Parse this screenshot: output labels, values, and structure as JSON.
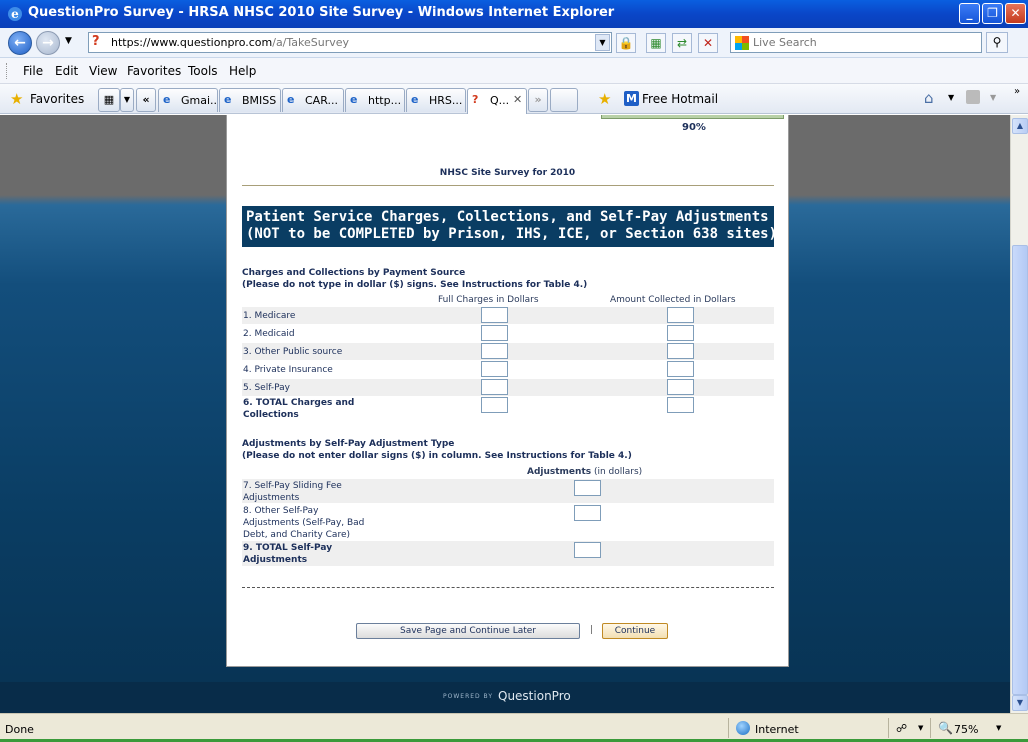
{
  "window": {
    "title": "QuestionPro Survey - HRSA NHSC 2010 Site Survey - Windows Internet Explorer",
    "minimize": "_",
    "maximize": "❐",
    "close": "✕"
  },
  "address": {
    "url_prefix": "https://",
    "url_host": "www.questionpro.com",
    "url_path": "/a/TakeSurvey",
    "search_placeholder": "Live Search"
  },
  "menu": [
    "File",
    "Edit",
    "View",
    "Favorites",
    "Tools",
    "Help"
  ],
  "favorites_bar": {
    "favorites_label": "Favorites",
    "tabs": [
      "Gmai...",
      "BMISS",
      "CAR...",
      "http...",
      "HRS...",
      "Q..."
    ],
    "tab_scroll_left": "«",
    "tab_scroll_right": "»",
    "hotmail_label": "Free Hotmail"
  },
  "survey": {
    "progress_percent": "90%",
    "progress_fraction": 0.9,
    "title": "NHSC Site Survey for 2010",
    "section_header_line1": "Patient Service Charges, Collections, and Self-Pay Adjustments",
    "section_header_line2": "(NOT to be COMPLETED by Prison, IHS, ICE, or Section 638 sites)",
    "q1": {
      "title": "Charges and Collections by Payment Source",
      "subtitle": "(Please do not type in dollar ($) signs. See Instructions for Table 4.)",
      "col1": "Full Charges in Dollars",
      "col2": "Amount Collected in Dollars",
      "rows": [
        "1. Medicare",
        "2. Medicaid",
        "3. Other Public source",
        "4. Private Insurance",
        "5. Self-Pay",
        "6. TOTAL Charges and Collections"
      ]
    },
    "q2": {
      "title": "Adjustments by Self-Pay Adjustment Type",
      "subtitle": "(Please do not enter dollar signs ($) in column. See Instructions for Table 4.)",
      "col_bold": "Adjustments",
      "col_rest": "(in dollars)",
      "rows": [
        "7. Self-Pay Sliding Fee Adjustments",
        "8. Other Self-Pay Adjustments (Self-Pay, Bad Debt, and Charity Care)",
        "9. TOTAL Self-Pay Adjustments"
      ]
    },
    "save_button": "Save Page and Continue Later",
    "separator": "|",
    "continue_button": "Continue"
  },
  "footer": {
    "powered_by": "POWERED BY",
    "brand": "QuestionPro"
  },
  "status": {
    "text": "Done",
    "zone": "Internet",
    "zoom": "75%"
  }
}
